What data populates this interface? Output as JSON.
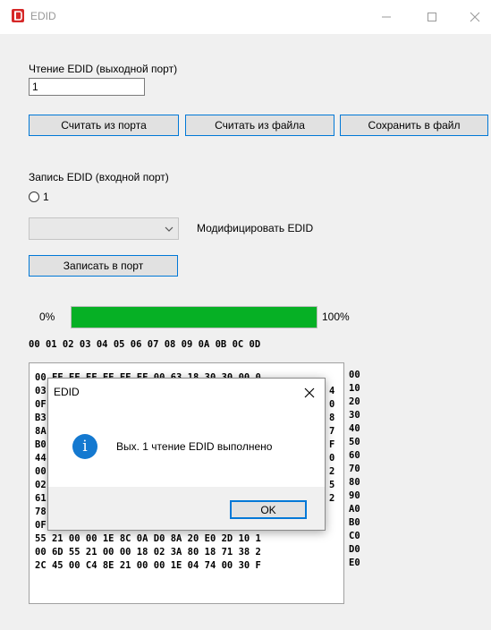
{
  "window": {
    "title": "EDID",
    "accent": "#0078d7"
  },
  "read_section": {
    "label": "Чтение EDID (выходной порт)",
    "port_value": "1",
    "buttons": {
      "read_port": "Считать из порта",
      "read_file": "Считать из файла",
      "save_file": "Сохранить в файл"
    }
  },
  "write_section": {
    "label": "Запись EDID (входной порт)",
    "radio_label": "1",
    "combo_value": "",
    "modify_label": "Модифицировать EDID",
    "write_button": "Записать в порт"
  },
  "progress": {
    "start_label": "0%",
    "end_label": "100%",
    "value": 1.0,
    "fill_color": "#06b025"
  },
  "hex": {
    "header": "00 01 02 03 04 05 06 07 08 09 0A 0B 0C 0D",
    "rows": [
      "00 FF FF FF FF FF FF 00 63 18 30 30 00 0",
      "03",
      "0F",
      "B3",
      "8A",
      "B0",
      "44",
      "00",
      "02",
      "61",
      "78 20 00 60 01 02 03 67 D8 5D C4 01 78 8",
      "0F 00 0C 01 1D 00 72 51 D0 1E 20 6E 28 5",
      "55 21 00 00 1E 8C 0A D0 8A 20 E0 2D 10 1",
      "00 6D 55 21 00 00 18 02 3A 80 18 71 38 2",
      "2C 45 00 C4 8E 21 00 00 1E 04 74 00 30 F"
    ],
    "right_edge": [
      "0",
      "4",
      "0",
      "8",
      "7",
      "F",
      "0",
      "2",
      "5",
      "2"
    ],
    "addresses": [
      "00",
      "10",
      "20",
      "30",
      "40",
      "50",
      "60",
      "70",
      "80",
      "90",
      "A0",
      "B0",
      "C0",
      "D0",
      "E0"
    ]
  },
  "dialog": {
    "title": "EDID",
    "message": "Вых. 1 чтение EDID выполнено",
    "ok_label": "OK",
    "icon": "info-icon"
  }
}
